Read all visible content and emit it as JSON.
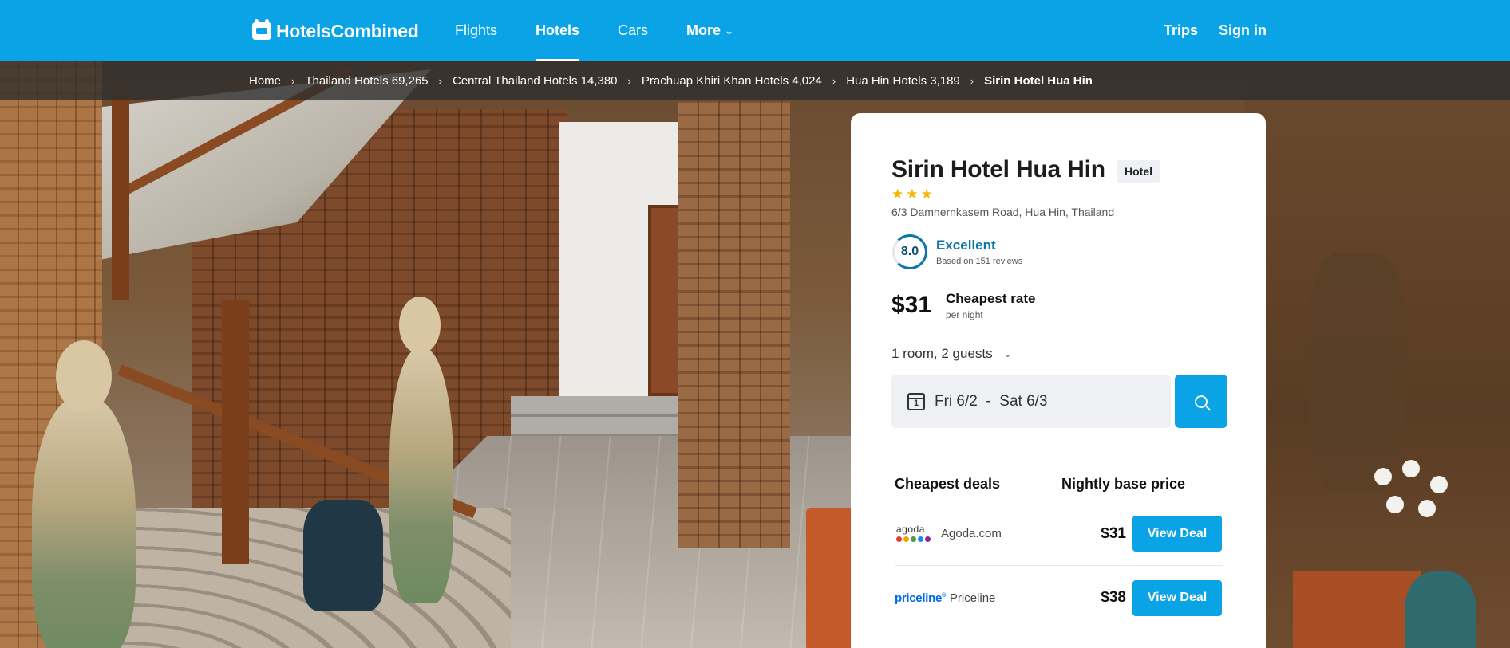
{
  "app": {
    "logo_text": "HotelsCombined"
  },
  "nav": {
    "items": [
      {
        "label": "Flights"
      },
      {
        "label": "Hotels"
      },
      {
        "label": "Cars"
      },
      {
        "label": "More"
      }
    ],
    "trips": "Trips",
    "sign_in": "Sign in"
  },
  "breadcrumb": [
    {
      "label": "Home"
    },
    {
      "label": "Thailand Hotels 69,265"
    },
    {
      "label": "Central Thailand Hotels 14,380"
    },
    {
      "label": "Prachuap Khiri Khan Hotels 4,024"
    },
    {
      "label": "Hua Hin Hotels 3,189"
    },
    {
      "label": "Sirin Hotel Hua Hin"
    }
  ],
  "hotel": {
    "name": "Sirin Hotel Hua Hin",
    "type": "Hotel",
    "stars": 3,
    "stars_text": "★★★",
    "address": "6/3 Damnernkasem Road, Hua Hin, Thailand",
    "score": "8.0",
    "score_label": "Excellent",
    "reviews": "Based on 151 reviews",
    "price": "$31",
    "rate_label": "Cheapest rate",
    "rate_sub": "per night"
  },
  "search": {
    "guests": "1 room, 2 guests",
    "calendar_day": "1",
    "dates": "Fri 6/2  -  Sat 6/3"
  },
  "deals": {
    "head_left": "Cheapest deals",
    "head_right": "Nightly base price",
    "rows": [
      {
        "logo": "agoda",
        "provider": "Agoda.com",
        "price": "$31",
        "button": "View Deal"
      },
      {
        "logo": "priceline",
        "provider": "Priceline",
        "price": "$38",
        "button": "View Deal"
      }
    ]
  },
  "colors": {
    "brand_blue": "#0aa3e6",
    "score_blue": "#0b77a8",
    "star_yellow": "#f5b400",
    "agoda_dots": [
      "#e53935",
      "#f4a300",
      "#43a047",
      "#1e88e5",
      "#8e24aa"
    ]
  }
}
